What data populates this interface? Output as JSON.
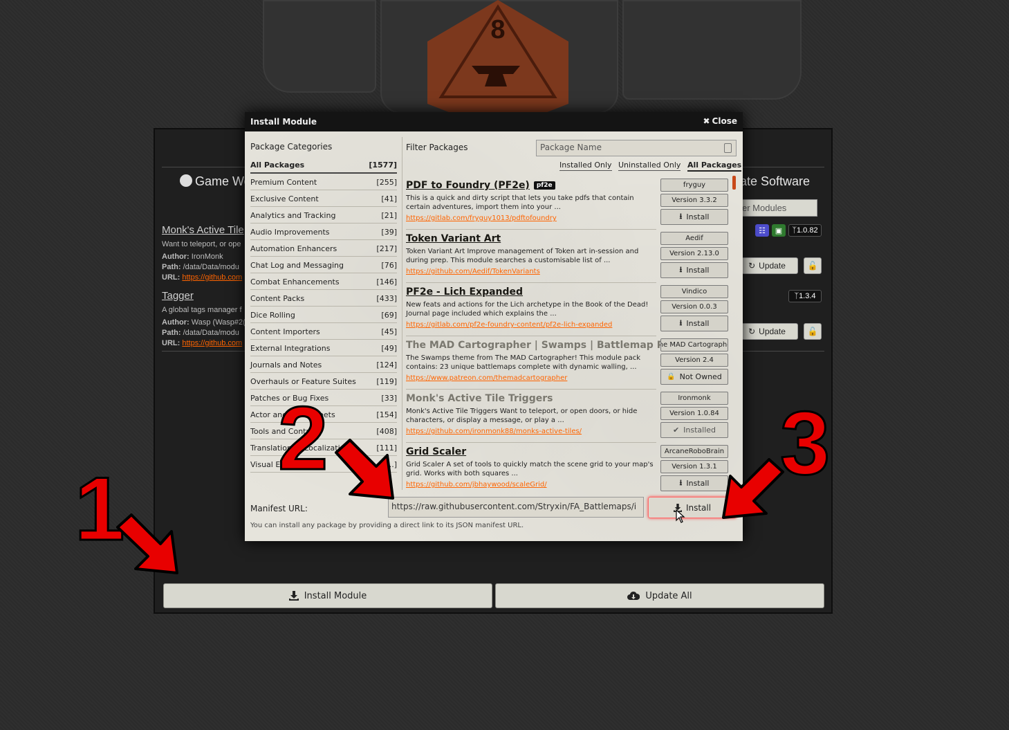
{
  "background": {
    "tabs": {
      "game_worlds": "Game Wo",
      "update_software": "ate Software"
    },
    "search_placeholder": "er Modules",
    "modules": [
      {
        "title": "Monk's Active Tile",
        "desc": "Want to teleport, or ope",
        "author_label": "Author:",
        "author": "IronMonk",
        "path_label": "Path:",
        "path": "/data/Data/modu",
        "url_label": "URL:",
        "url": "https://github.com",
        "version": "1.0.82",
        "update_label": "Update"
      },
      {
        "title": "Tagger",
        "desc": "A global tags manager f",
        "author_label": "Author:",
        "author": "Wasp (Wasp#2(",
        "path_label": "Path:",
        "path": "/data/Data/modu",
        "url_label": "URL:",
        "url": "https://github.com",
        "version": "1.3.4",
        "update_label": "Update"
      }
    ],
    "install_module_label": "Install Module",
    "update_all_label": "Update All"
  },
  "dialog": {
    "title": "Install Module",
    "close_label": "Close",
    "categories_heading": "Package Categories",
    "categories": [
      {
        "name": "All Packages",
        "count": "[1577]"
      },
      {
        "name": "Premium Content",
        "count": "[255]"
      },
      {
        "name": "Exclusive Content",
        "count": "[41]"
      },
      {
        "name": "Analytics and Tracking",
        "count": "[21]"
      },
      {
        "name": "Audio Improvements",
        "count": "[39]"
      },
      {
        "name": "Automation Enhancers",
        "count": "[217]"
      },
      {
        "name": "Chat Log and Messaging",
        "count": "[76]"
      },
      {
        "name": "Combat Enhancements",
        "count": "[146]"
      },
      {
        "name": "Content Packs",
        "count": "[433]"
      },
      {
        "name": "Dice Rolling",
        "count": "[69]"
      },
      {
        "name": "Content Importers",
        "count": "[45]"
      },
      {
        "name": "External Integrations",
        "count": "[49]"
      },
      {
        "name": "Journals and Notes",
        "count": "[124]"
      },
      {
        "name": "Overhauls or Feature Suites",
        "count": "[119]"
      },
      {
        "name": "Patches or Bug Fixes",
        "count": "[33]"
      },
      {
        "name": "Actor and Item Sheets",
        "count": "[154]"
      },
      {
        "name": "Tools and Controls",
        "count": "[408]"
      },
      {
        "name": "Translation or Localization",
        "count": "[111]"
      },
      {
        "name": "Visual Effects",
        "count": "[...]"
      }
    ],
    "filter_label": "Filter Packages",
    "search_placeholder": "Package Name",
    "filters": {
      "installed": "Installed Only",
      "uninstalled": "Uninstalled Only",
      "all": "All Packages"
    },
    "packages": [
      {
        "title": "PDF to Foundry (PF2e)",
        "tag": "pf2e",
        "desc": "This is a quick and dirty script that lets you take pdfs that contain certain adventures, import them into your ...",
        "url": "https://gitlab.com/fryguy1013/pdftofoundry",
        "author": "fryguy",
        "version": "Version 3.3.2",
        "action": "Install"
      },
      {
        "title": "Token Variant Art",
        "desc": "Token Variant Art Improve management of Token art in-session and during prep.   This module searches a customisable list of ...",
        "url": "https://github.com/Aedif/TokenVariants",
        "author": "Aedif",
        "version": "Version 2.13.0",
        "action": "Install"
      },
      {
        "title": "PF2e - Lich Expanded",
        "desc": "New feats and actions for the Lich archetype in the Book of the Dead! Journal page included which explains the ...",
        "url": "https://gitlab.com/pf2e-foundry-content/pf2e-lich-expanded",
        "author": "Vindico",
        "version": "Version 0.0.3",
        "action": "Install"
      },
      {
        "title": "The MAD Cartographer | Swamps | Battlemap Pack",
        "desc": "  The Swamps theme from The MAD Cartographer!    This module pack contains: 23 unique battlemaps complete with dynamic walling, ...",
        "url": "https://www.patreon.com/themadcartographer",
        "author": "The MAD Cartographer",
        "version": "Version 2.4",
        "action": "Not Owned"
      },
      {
        "title": "Monk's Active Tile Triggers",
        "desc": "Monk's Active Tile Triggers Want to teleport, or open doors, or hide characters, or display a message, or play a ...",
        "url": "https://github.com/ironmonk88/monks-active-tiles/",
        "author": "Ironmonk",
        "version": "Version 1.0.84",
        "action": "Installed"
      },
      {
        "title": "Grid Scaler",
        "desc": "Grid Scaler A set of tools to quickly match the scene grid to your map's grid. Works with both squares ...",
        "url": "https://github.com/jbhaywood/scaleGrid/",
        "author": "ArcaneRoboBrain",
        "version": "Version 1.3.1",
        "action": "Install"
      }
    ],
    "manifest_label": "Manifest URL:",
    "manifest_value": "https://raw.githubusercontent.com/Stryxin/FA_Battlemaps/i",
    "manifest_install_label": "Install",
    "manifest_hint": "You can install any package by providing a direct link to its JSON manifest URL."
  },
  "annotations": [
    "1",
    "2",
    "3"
  ],
  "colors": {
    "accent": "#ff6400",
    "annotation": "#e80000",
    "header": "#141414"
  }
}
